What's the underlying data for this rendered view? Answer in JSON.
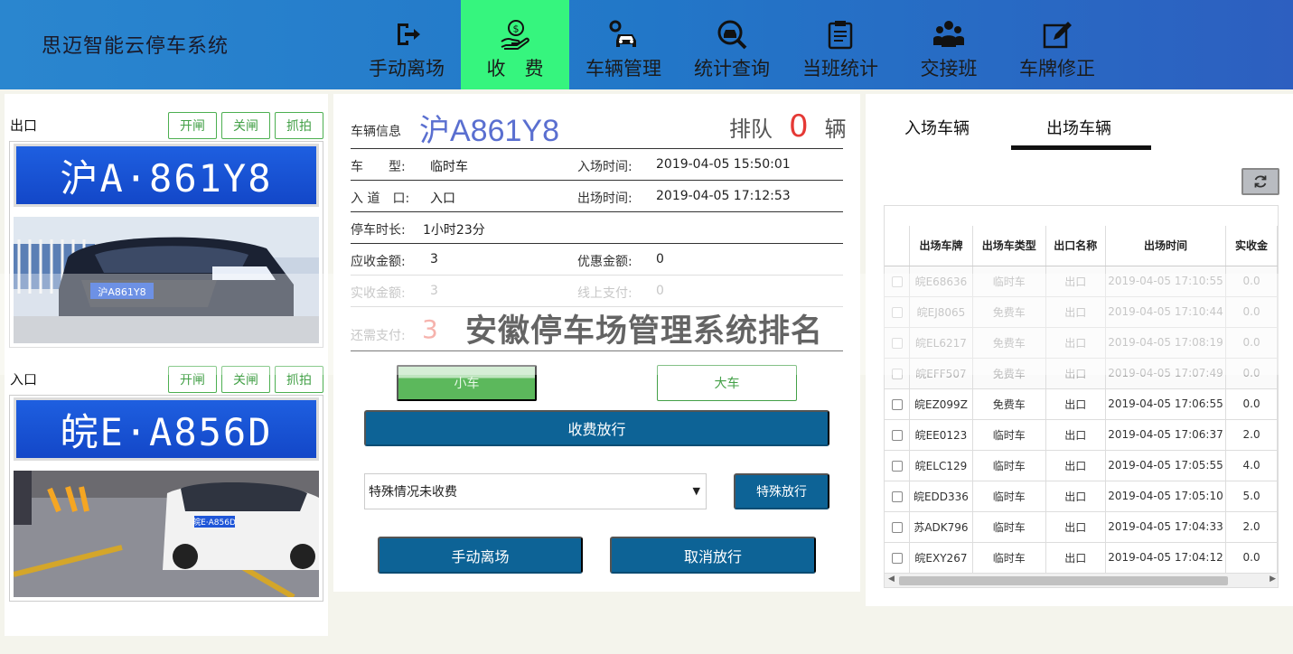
{
  "header": {
    "app_title": "思迈智能云停车系统",
    "nav": [
      {
        "label": "手动离场",
        "icon": "exit-icon",
        "active": false
      },
      {
        "label": "收　费",
        "icon": "money-hand-icon",
        "active": true
      },
      {
        "label": "车辆管理",
        "icon": "car-gear-icon",
        "active": false
      },
      {
        "label": "统计查询",
        "icon": "car-search-icon",
        "active": false
      },
      {
        "label": "当班统计",
        "icon": "clipboard-icon",
        "active": false
      },
      {
        "label": "交接班",
        "icon": "people-group-icon",
        "active": false
      },
      {
        "label": "车牌修正",
        "icon": "edit-icon",
        "active": false
      }
    ],
    "active_color": "#36f57e"
  },
  "cameras": {
    "exit": {
      "title": "出口",
      "buttons": {
        "open": "开闸",
        "close": "关闸",
        "capture": "抓拍"
      },
      "plate_text": "沪A·861Y8",
      "car_plate_small": "沪A861Y8"
    },
    "entry": {
      "title": "入口",
      "buttons": {
        "open": "开闸",
        "close": "关闸",
        "capture": "抓拍"
      },
      "plate_text": "皖E·A856D",
      "car_plate_small": "皖E·A856D"
    }
  },
  "vehicle": {
    "info_label": "车辆信息",
    "plate": "沪A861Y8",
    "queue_label": "排队",
    "queue_count": "0",
    "queue_unit": "辆",
    "type_label": "车　　型:",
    "type_value": "临时车",
    "in_time_label": "入场时间:",
    "in_time_value": "2019-04-05 15:50:01",
    "lane_label": "入 道　口:",
    "lane_value": "入口",
    "out_time_label": "出场时间:",
    "out_time_value": "2019-04-05 17:12:53",
    "duration_label": "停车时长:",
    "duration_value": "1小时23分",
    "due_label": "应收金额:",
    "due_value": "3",
    "discount_label": "优惠金额:",
    "discount_value": "0",
    "paid_label": "实收金额:",
    "paid_value": "3",
    "online_label": "线上支付:",
    "online_value": "0",
    "remaining_label": "还需支付:",
    "remaining_value": "3",
    "overlay_text": "安徽停车场管理系统排名"
  },
  "actions": {
    "small_car": "小车",
    "large_car": "大车",
    "charge_release": "收费放行",
    "special_select": "特殊情况未收费",
    "special_release": "特殊放行",
    "manual_exit": "手动离场",
    "cancel_release": "取消放行"
  },
  "records": {
    "tabs": [
      "入场车辆",
      "出场车辆"
    ],
    "active_tab": 1,
    "columns": [
      "出场车牌",
      "出场车类型",
      "出口名称",
      "出场时间",
      "实收金"
    ],
    "rows": [
      {
        "plate": "皖E68636",
        "type": "临时车",
        "exit": "出口",
        "time": "2019-04-05 17:10:55",
        "paid": "0.0",
        "faded": true
      },
      {
        "plate": "皖EJ8065",
        "type": "免费车",
        "exit": "出口",
        "time": "2019-04-05 17:10:44",
        "paid": "0.0",
        "faded": true
      },
      {
        "plate": "皖EL6217",
        "type": "免费车",
        "exit": "出口",
        "time": "2019-04-05 17:08:19",
        "paid": "0.0",
        "faded": true
      },
      {
        "plate": "皖EFF507",
        "type": "免费车",
        "exit": "出口",
        "time": "2019-04-05 17:07:49",
        "paid": "0.0",
        "faded": true
      },
      {
        "plate": "皖EZ099Z",
        "type": "免费车",
        "exit": "出口",
        "time": "2019-04-05 17:06:55",
        "paid": "0.0",
        "faded": false
      },
      {
        "plate": "皖EE0123",
        "type": "临时车",
        "exit": "出口",
        "time": "2019-04-05 17:06:37",
        "paid": "2.0",
        "faded": false
      },
      {
        "plate": "皖ELC129",
        "type": "临时车",
        "exit": "出口",
        "time": "2019-04-05 17:05:55",
        "paid": "4.0",
        "faded": false
      },
      {
        "plate": "皖EDD336",
        "type": "临时车",
        "exit": "出口",
        "time": "2019-04-05 17:05:10",
        "paid": "5.0",
        "faded": false
      },
      {
        "plate": "苏ADK796",
        "type": "临时车",
        "exit": "出口",
        "time": "2019-04-05 17:04:33",
        "paid": "2.0",
        "faded": false
      },
      {
        "plate": "皖EXY267",
        "type": "临时车",
        "exit": "出口",
        "time": "2019-04-05 17:04:12",
        "paid": "0.0",
        "faded": false
      }
    ]
  }
}
